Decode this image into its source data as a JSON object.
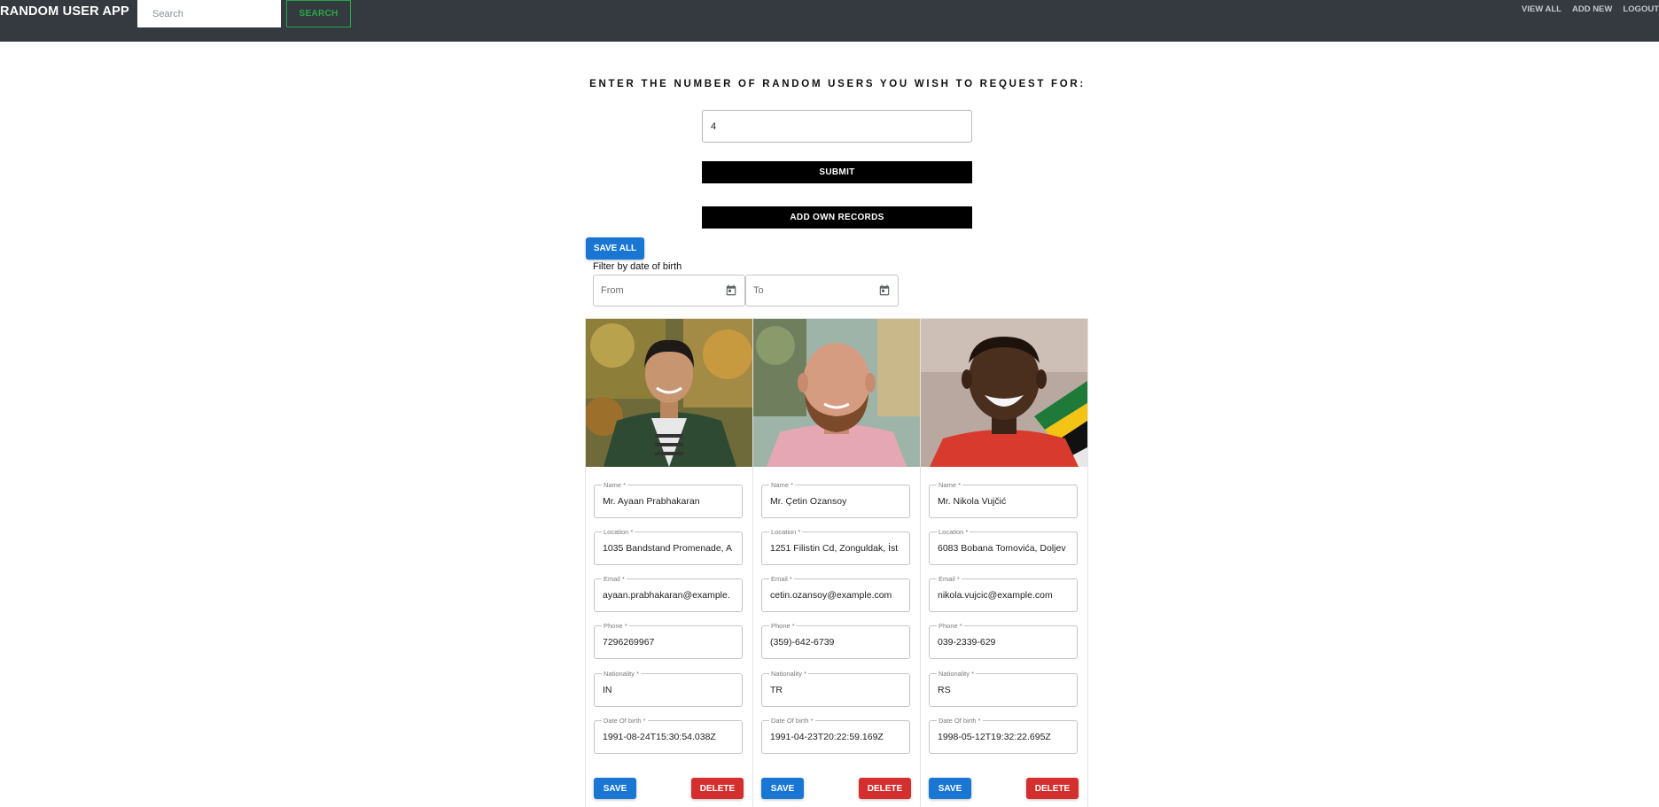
{
  "navbar": {
    "brand": "RANDOM USER APP",
    "search_placeholder": "Search",
    "search_button": "SEARCH",
    "links": [
      "VIEW ALL",
      "ADD NEW",
      "LOGOUT"
    ]
  },
  "request": {
    "title": "ENTER THE NUMBER OF RANDOM USERS YOU WISH TO REQUEST FOR:",
    "count_value": "4",
    "submit_label": "SUBMIT",
    "add_own_label": "ADD OWN RECORDS"
  },
  "save_all_label": "SAVE ALL",
  "filter": {
    "label": "Filter by date of birth",
    "from_placeholder": "From",
    "to_placeholder": "To"
  },
  "field_labels": {
    "name": "Name *",
    "location": "Location *",
    "email": "Email *",
    "phone": "Phone *",
    "nationality": "Nationality *",
    "dob": "Date Of birth *"
  },
  "cards": [
    {
      "name": "Mr. Ayaan Prabhakaran",
      "location": "1035 Bandstand Promenade, A",
      "email": "ayaan.prabhakaran@example.",
      "phone": "7296269967",
      "nationality": "IN",
      "dob": "1991-08-24T15:30:54.038Z",
      "save": "SAVE",
      "delete": "DELETE"
    },
    {
      "name": "Mr. Çetin Ozansoy",
      "location": "1251 Filistin Cd, Zonguldak, İst",
      "email": "cetin.ozansoy@example.com",
      "phone": "(359)-642-6739",
      "nationality": "TR",
      "dob": "1991-04-23T20:22:59.169Z",
      "save": "SAVE",
      "delete": "DELETE"
    },
    {
      "name": "Mr. Nikola Vujčić",
      "location": "6083 Bobana Tomovića, Doljev",
      "email": "nikola.vujcic@example.com",
      "phone": "039-2339-629",
      "nationality": "RS",
      "dob": "1998-05-12T19:32:22.695Z",
      "save": "SAVE",
      "delete": "DELETE"
    }
  ],
  "colors": {
    "navbar_bg": "#343a40",
    "search_btn": "#28a745",
    "primary": "#1976d2",
    "danger": "#d32f2f"
  },
  "icons": {
    "date_picker": "calendar-icon"
  }
}
